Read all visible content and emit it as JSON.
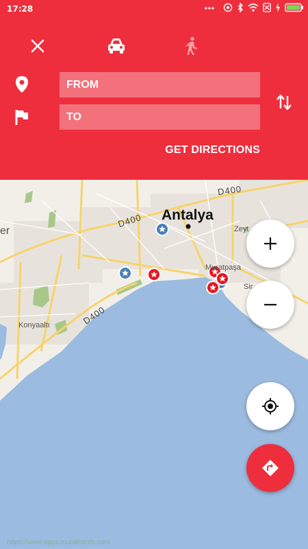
{
  "status_bar": {
    "time": "17:28"
  },
  "header": {
    "from_placeholder": "FROM",
    "to_placeholder": "TO",
    "get_directions_label": "GET DIRECTIONS"
  },
  "map": {
    "city_label": "Antalya",
    "road_labels": [
      "D400",
      "D400",
      "D400"
    ],
    "district_labels": [
      "Konyaaltı",
      "Muratpaşa",
      "Zeyt",
      "Sir",
      "er"
    ],
    "watermark": "https://www.apps.muratnerds.com"
  },
  "colors": {
    "accent": "#ee2e3d",
    "sea": "#9bbbe0",
    "land": "#f2efe9",
    "road": "#f7d36a"
  },
  "icons": {
    "close": "close-icon",
    "car": "car-icon",
    "walk": "walk-icon",
    "location": "location-pin-icon",
    "flag": "flag-icon",
    "swap": "swap-vertical-icon",
    "zoom_in": "plus-icon",
    "zoom_out": "minus-icon",
    "my_location": "crosshair-icon",
    "directions": "directions-icon"
  }
}
